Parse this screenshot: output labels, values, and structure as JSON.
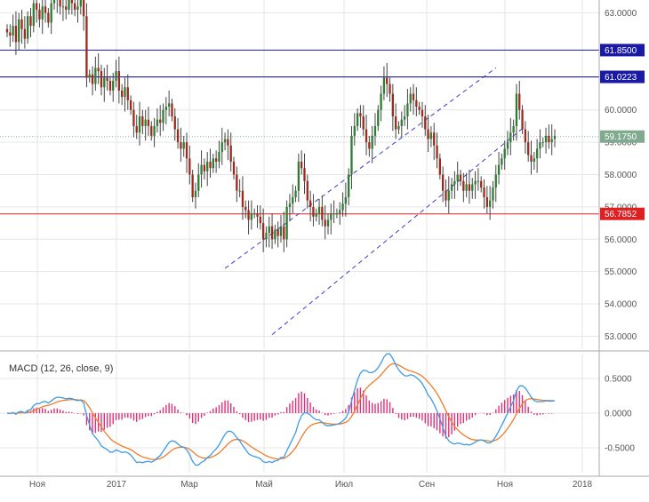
{
  "chart_data": [
    {
      "type": "candlestick",
      "x_ticks": [
        "Ноя",
        "2017",
        "Мар",
        "Май",
        "Июл",
        "Сен",
        "Ноя",
        "2018"
      ],
      "y_ticks": [
        "63.0000",
        "61.0000",
        "60.0000",
        "59.0000",
        "58.0000",
        "57.0000",
        "56.0000",
        "55.0000",
        "54.0000",
        "53.0000"
      ],
      "ylim": [
        52.6,
        63.4
      ],
      "grid": true,
      "closes": [
        62.4,
        62.3,
        62.6,
        62.1,
        62.8,
        62.5,
        62.2,
        62.9,
        62.6,
        63.3,
        63.1,
        62.8,
        63.2,
        63.0,
        62.7,
        63.3,
        63.5,
        63.4,
        63.2,
        63.2,
        63.1,
        63.4,
        63.3,
        63.1,
        63.2,
        63.4,
        62.9,
        61.0,
        61.1,
        60.8,
        61.3,
        61.2,
        60.7,
        61.0,
        60.9,
        60.6,
        60.9,
        61.2,
        60.6,
        60.4,
        60.7,
        60.3,
        60.0,
        59.5,
        59.3,
        59.8,
        59.5,
        59.7,
        59.5,
        59.2,
        59.5,
        59.7,
        59.6,
        60.0,
        60.1,
        60.2,
        59.8,
        59.4,
        59.0,
        58.8,
        59.0,
        58.5,
        58.0,
        57.3,
        57.5,
        58.0,
        58.3,
        58.1,
        58.4,
        58.2,
        58.5,
        58.4,
        58.7,
        59.0,
        59.1,
        58.9,
        58.4,
        58.0,
        57.5,
        57.5,
        57.0,
        56.9,
        56.6,
        56.8,
        56.8,
        56.7,
        56.5,
        56.0,
        56.2,
        56.4,
        56.0,
        56.3,
        56.1,
        56.4,
        56.0,
        57.0,
        57.1,
        57.3,
        57.5,
        58.4,
        58.2,
        57.8,
        57.2,
        57.0,
        56.7,
        56.8,
        57.0,
        56.6,
        56.4,
        56.6,
        56.8,
        56.8,
        56.8,
        56.9,
        57.1,
        57.3,
        58.0,
        59.2,
        59.5,
        59.9,
        59.8,
        59.4,
        59.0,
        58.8,
        59.2,
        59.5,
        60.0,
        60.5,
        61.0,
        60.8,
        60.5,
        59.8,
        59.4,
        59.5,
        59.7,
        59.8,
        60.2,
        60.5,
        60.3,
        60.1,
        60.0,
        59.8,
        59.4,
        59.1,
        59.3,
        58.9,
        58.5,
        58.0,
        57.5,
        57.2,
        57.5,
        57.7,
        57.8,
        58.0,
        57.8,
        57.5,
        57.7,
        57.5,
        57.7,
        57.8,
        57.8,
        57.6,
        57.3,
        57.0,
        57.2,
        57.6,
        58.0,
        58.3,
        58.5,
        58.8,
        59.0,
        59.3,
        59.5,
        60.5,
        60.0,
        59.4,
        59.0,
        58.6,
        58.4,
        58.5,
        58.8,
        59.0,
        59.0,
        59.2,
        59.0,
        59.1,
        59.2
      ],
      "opens": [
        62.5,
        62.4,
        62.3,
        62.6,
        62.1,
        62.8,
        62.5,
        62.2,
        62.9,
        62.6,
        63.3,
        63.1,
        62.8,
        63.2,
        63.0,
        62.7,
        63.3,
        63.5,
        63.4,
        63.2,
        63.2,
        63.1,
        63.4,
        63.3,
        63.1,
        63.2,
        63.4,
        62.9,
        61.0,
        61.1,
        60.8,
        61.3,
        61.2,
        60.7,
        61.0,
        60.9,
        60.6,
        60.9,
        61.2,
        60.6,
        60.4,
        60.7,
        60.3,
        60.0,
        59.5,
        59.3,
        59.8,
        59.5,
        59.7,
        59.5,
        59.2,
        59.5,
        59.7,
        59.6,
        60.0,
        60.1,
        60.2,
        59.8,
        59.4,
        59.0,
        58.8,
        59.0,
        58.5,
        58.0,
        57.3,
        57.5,
        58.0,
        58.3,
        58.1,
        58.4,
        58.2,
        58.5,
        58.4,
        58.7,
        59.0,
        59.1,
        58.9,
        58.4,
        58.0,
        57.5,
        57.5,
        57.0,
        56.9,
        56.6,
        56.8,
        56.8,
        56.7,
        56.5,
        56.0,
        56.2,
        56.4,
        56.0,
        56.3,
        56.1,
        56.4,
        56.0,
        57.0,
        57.1,
        57.3,
        57.5,
        58.4,
        58.2,
        57.8,
        57.2,
        57.0,
        56.7,
        56.8,
        57.0,
        56.6,
        56.4,
        56.6,
        56.8,
        56.8,
        56.8,
        56.9,
        57.1,
        57.3,
        58.0,
        59.2,
        59.5,
        59.9,
        59.8,
        59.4,
        59.0,
        58.8,
        59.2,
        59.5,
        60.0,
        60.5,
        61.0,
        60.8,
        60.5,
        59.8,
        59.4,
        59.5,
        59.7,
        59.8,
        60.2,
        60.5,
        60.3,
        60.1,
        60.0,
        59.8,
        59.4,
        59.1,
        59.3,
        58.9,
        58.5,
        58.0,
        57.5,
        57.2,
        57.5,
        57.7,
        57.8,
        58.0,
        57.8,
        57.5,
        57.7,
        57.5,
        57.7,
        57.8,
        57.8,
        57.6,
        57.3,
        57.0,
        57.2,
        57.6,
        58.0,
        58.3,
        58.5,
        58.8,
        59.0,
        59.3,
        59.5,
        60.5,
        60.0,
        59.4,
        59.0,
        58.6,
        58.4,
        58.5,
        58.8,
        59.0,
        59.0,
        59.2,
        59.0,
        59.1
      ],
      "levels": [
        {
          "label": "61.8500",
          "value": 61.85,
          "color": "#1a1aa6"
        },
        {
          "label": "61.0223",
          "value": 61.0223,
          "color": "#1a1aa6"
        },
        {
          "label": "59.1750",
          "value": 59.175,
          "color": "#8fb89f",
          "dotted": true
        },
        {
          "label": "56.7852",
          "value": 56.7852,
          "color": "#e02020"
        }
      ],
      "channel_lines": [
        {
          "from": [
            74,
            55.1
          ],
          "to": [
            166,
            61.3
          ]
        },
        {
          "from": [
            90,
            53.05
          ],
          "to": [
            176,
            59.5
          ]
        }
      ],
      "colors": {
        "up": "#2e7d32",
        "down": "#9e2a1e",
        "wick": "#444444",
        "grid": "#e6e6e6",
        "channel": "#3b3bd6"
      }
    },
    {
      "type": "macd",
      "title": "MACD (12, 26, close, 9)",
      "y_ticks": [
        "0.5000",
        "0.0000",
        "-0.5000"
      ],
      "ylim": [
        -0.86,
        0.86
      ],
      "colors": {
        "macd": "#3d9be9",
        "signal": "#f07d2a",
        "hist": "#e0307a"
      }
    }
  ]
}
